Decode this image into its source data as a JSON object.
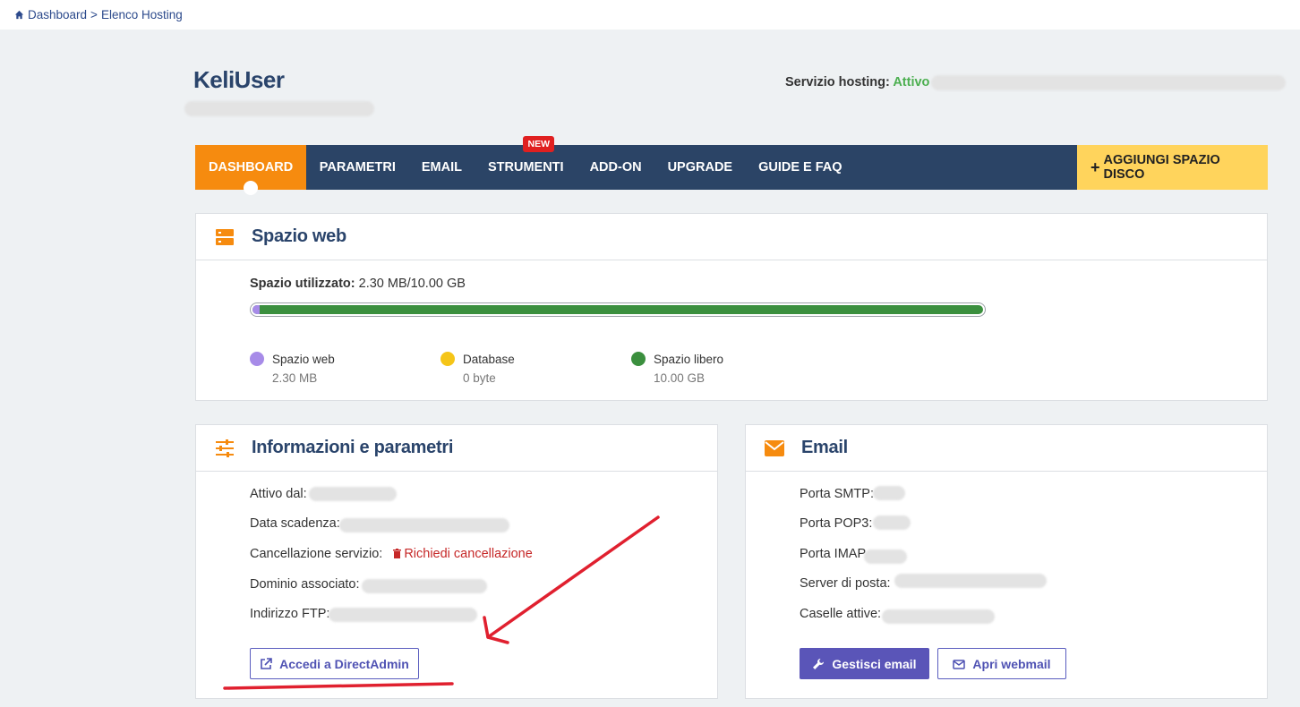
{
  "breadcrumb": {
    "home_label": "Dashboard",
    "separator": ">",
    "current": "Elenco Hosting"
  },
  "header": {
    "username": "KeliUser",
    "service_label": "Servizio hosting:",
    "service_status": "Attivo"
  },
  "nav": {
    "items": [
      {
        "label": "DASHBOARD",
        "active": true
      },
      {
        "label": "PARAMETRI"
      },
      {
        "label": "EMAIL"
      },
      {
        "label": "STRUMENTI",
        "badge": "NEW"
      },
      {
        "label": "ADD-ON"
      },
      {
        "label": "UPGRADE"
      },
      {
        "label": "GUIDE E FAQ"
      }
    ],
    "cta_label": "AGGIUNGI SPAZIO DISCO"
  },
  "web_space": {
    "title": "Spazio web",
    "usage_label": "Spazio utilizzato:",
    "usage_value": "2.30 MB/10.00 GB",
    "used_fraction": 0.0002,
    "legend": [
      {
        "name": "Spazio web",
        "value": "2.30 MB",
        "color": "#a78be8"
      },
      {
        "name": "Database",
        "value": "0 byte",
        "color": "#f5c518"
      },
      {
        "name": "Spazio libero",
        "value": "10.00 GB",
        "color": "#3b8f3e"
      }
    ]
  },
  "info": {
    "title": "Informazioni e parametri",
    "active_since_label": "Attivo dal:",
    "expiry_label": "Data scadenza:",
    "cancel_label": "Cancellazione servizio:",
    "cancel_link": "Richiedi cancellazione",
    "domain_label": "Dominio associato:",
    "ftp_label": "Indirizzo FTP:",
    "directadmin_button": "Accedi a DirectAdmin"
  },
  "email": {
    "title": "Email",
    "smtp_label": "Porta SMTP:",
    "pop3_label": "Porta POP3:",
    "imap_label": "Porta IMAP",
    "server_label": "Server di posta:",
    "mailboxes_label": "Caselle attive:",
    "manage_button": "Gestisci email",
    "webmail_button": "Apri webmail"
  },
  "colors": {
    "accent_orange": "#f68b0f",
    "navy": "#2b4466",
    "cta_yellow": "#ffd45c",
    "status_green": "#4caf50",
    "button_purple": "#5a55b8",
    "annotation_red": "#e0202f"
  }
}
